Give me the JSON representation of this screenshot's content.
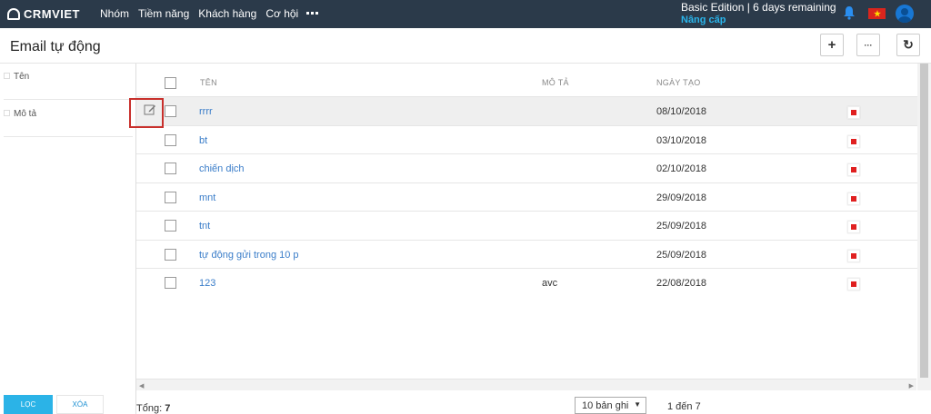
{
  "app": {
    "logo_text": "CRMVIET",
    "nav": [
      "Nhóm",
      "Tiềm năng",
      "Khách hàng",
      "Cơ hội"
    ],
    "plan_text": "Basic Edition | 6 days remaining",
    "upgrade_label": "Nâng cấp"
  },
  "page": {
    "title": "Email tự động",
    "add_label": "+",
    "more_label": "···",
    "refresh_label": "↻"
  },
  "filter": {
    "fields": [
      "Tên",
      "Mô tả"
    ],
    "apply_label": "LỌC",
    "clear_label": "XÓA"
  },
  "table": {
    "columns": {
      "name": "TÊN",
      "description": "MÔ TẢ",
      "created": "NGÀY TẠO"
    },
    "rows": [
      {
        "name": "rrrr",
        "description": "",
        "created": "08/10/2018"
      },
      {
        "name": "bt",
        "description": "",
        "created": "03/10/2018"
      },
      {
        "name": "chiến dịch",
        "description": "",
        "created": "02/10/2018"
      },
      {
        "name": "mnt",
        "description": "",
        "created": "29/09/2018"
      },
      {
        "name": "tnt",
        "description": "",
        "created": "25/09/2018"
      },
      {
        "name": "tự động gửi trong 10 p",
        "description": "",
        "created": "25/09/2018"
      },
      {
        "name": "123",
        "description": "avc",
        "created": "22/08/2018"
      }
    ]
  },
  "footer": {
    "total_label": "Tổng:",
    "total_value": "7",
    "page_size": "10 bản ghi",
    "range_text": "1 đến 7"
  },
  "colors": {
    "topbar": "#2b3a4a",
    "accent": "#2ab4ea",
    "link": "#3a7dc9",
    "delete": "#e02020",
    "highlight_border": "#c8302c"
  }
}
